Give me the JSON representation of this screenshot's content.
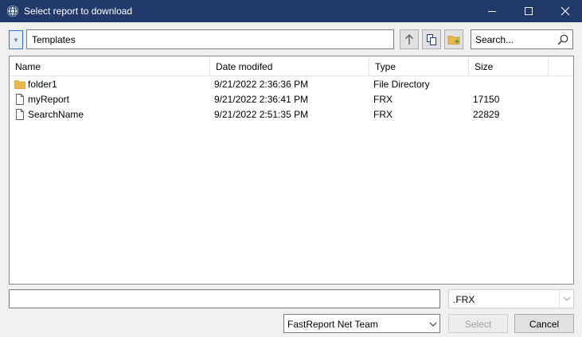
{
  "window": {
    "title": "Select report to download",
    "icon": "globe-icon",
    "controls": [
      "minimize-icon",
      "maximize-icon",
      "close-icon"
    ]
  },
  "toolbar": {
    "history_arrow": "▼",
    "path": "Templates",
    "buttons": [
      "arrow-up-icon",
      "copy-icon",
      "new-folder-icon"
    ],
    "search_placeholder": "Search..."
  },
  "list": {
    "columns": [
      "Name",
      "Date modifed",
      "Type",
      "Size"
    ],
    "rows": [
      {
        "icon": "folder-icon",
        "name": "folder1",
        "date": "9/21/2022 2:36:36 PM",
        "type": "File Directory",
        "size": ""
      },
      {
        "icon": "file-icon",
        "name": "myReport",
        "date": "9/21/2022 2:36:41 PM",
        "type": "FRX",
        "size": "17150"
      },
      {
        "icon": "file-icon",
        "name": "SearchName",
        "date": "9/21/2022 2:51:35 PM",
        "type": "FRX",
        "size": "22829"
      }
    ]
  },
  "footer": {
    "filename_value": "",
    "filter": ".FRX",
    "user": "FastReport Net Team",
    "select_label": "Select",
    "cancel_label": "Cancel"
  },
  "colors": {
    "titlebar": "#213a6b",
    "folder": "#e8b84a",
    "accent": "#2c73d2"
  }
}
